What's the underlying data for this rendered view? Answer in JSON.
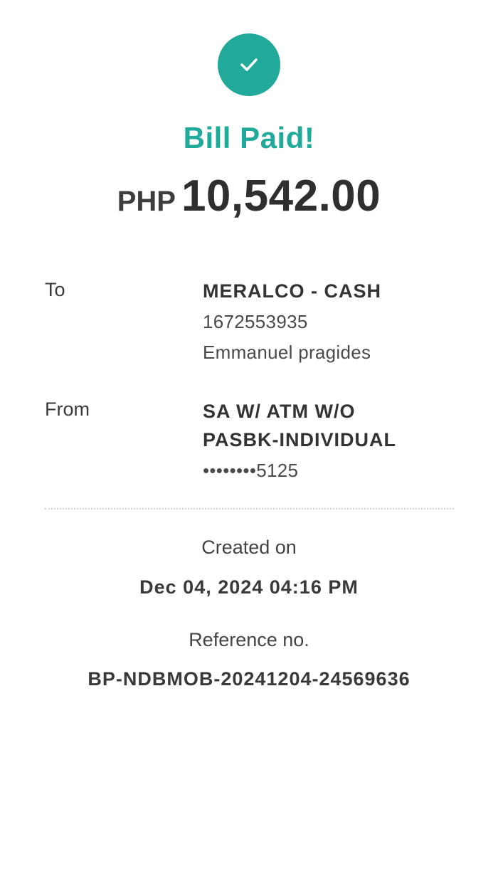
{
  "status": {
    "icon": "checkmark-icon",
    "title": "Bill Paid!"
  },
  "amount": {
    "currency": "PHP",
    "value": "10,542.00"
  },
  "to": {
    "label": "To",
    "biller": "MERALCO - CASH",
    "account_number": "1672553935",
    "account_name": "Emmanuel pragides"
  },
  "from": {
    "label": "From",
    "account_type_line1": "SA W/ ATM W/O",
    "account_type_line2": "PASBK-INDIVIDUAL",
    "masked_account": "••••••••5125"
  },
  "created": {
    "label": "Created on",
    "value": "Dec 04, 2024 04:16 PM"
  },
  "reference": {
    "label": "Reference no.",
    "value": "BP-NDBMOB-20241204-24569636"
  },
  "colors": {
    "accent": "#21a99a",
    "text": "#3a3a3a",
    "background": "#ffffff"
  }
}
